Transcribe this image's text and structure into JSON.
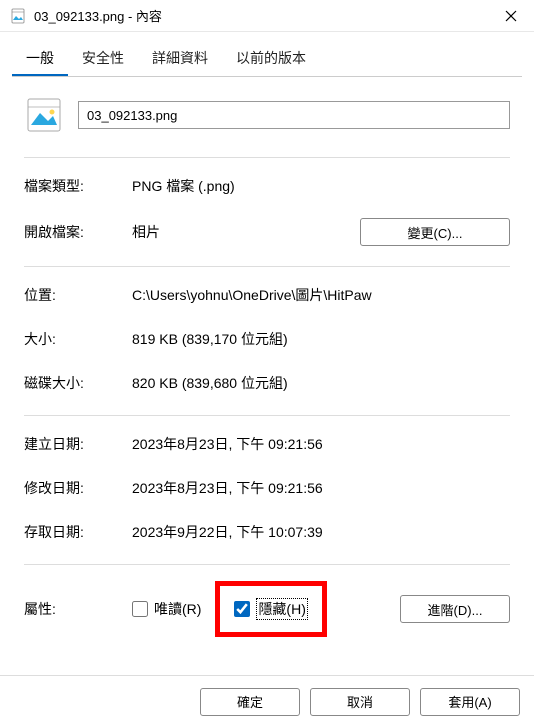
{
  "titlebar": {
    "title": "03_092133.png - 內容"
  },
  "tabs": {
    "general": "一般",
    "security": "安全性",
    "details": "詳細資料",
    "previous": "以前的版本"
  },
  "file": {
    "name": "03_092133.png"
  },
  "labels": {
    "filetype": "檔案類型:",
    "openswith": "開啟檔案:",
    "location": "位置:",
    "size": "大小:",
    "size_on_disk": "磁碟大小:",
    "created": "建立日期:",
    "modified": "修改日期:",
    "accessed": "存取日期:",
    "attributes": "屬性:"
  },
  "values": {
    "filetype": "PNG 檔案 (.png)",
    "openswith": "相片",
    "location": "C:\\Users\\yohnu\\OneDrive\\圖片\\HitPaw",
    "size": "819 KB (839,170 位元組)",
    "size_on_disk": "820 KB (839,680 位元組)",
    "created": "2023年8月23日, 下午 09:21:56",
    "modified": "2023年8月23日, 下午 09:21:56",
    "accessed": "2023年9月22日, 下午 10:07:39"
  },
  "buttons": {
    "change": "變更(C)...",
    "advanced": "進階(D)...",
    "ok": "確定",
    "cancel": "取消",
    "apply": "套用(A)"
  },
  "attrs": {
    "readonly": "唯讀(R)",
    "hidden": "隱藏(H)"
  }
}
